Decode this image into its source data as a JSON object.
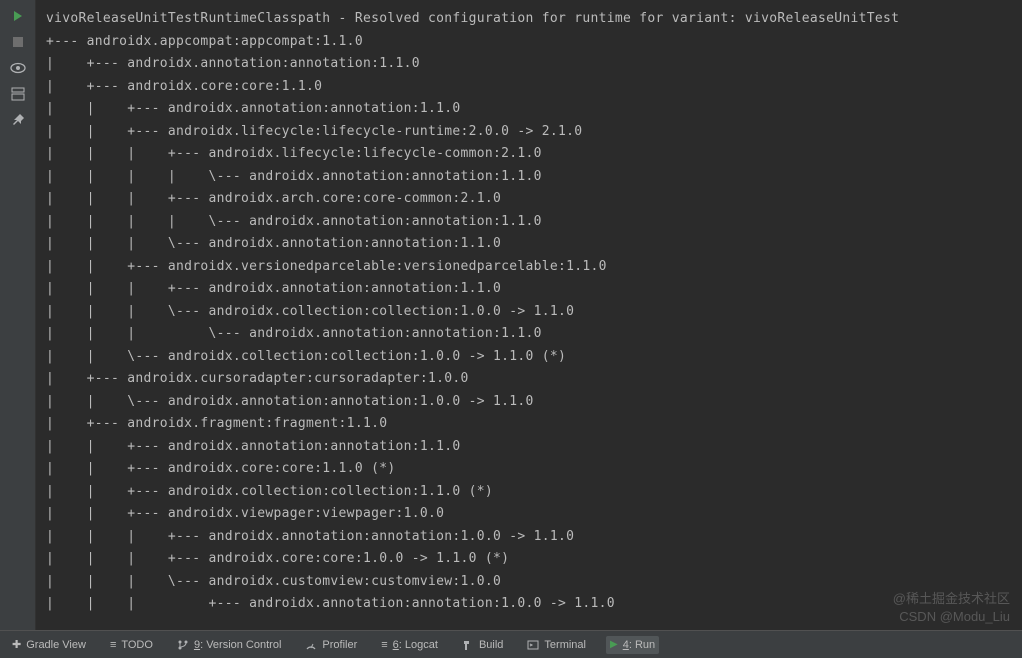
{
  "sidebar": {
    "icons": [
      "rerun",
      "stop",
      "view",
      "settings",
      "pin"
    ]
  },
  "console": {
    "lines": [
      "vivoReleaseUnitTestRuntimeClasspath - Resolved configuration for runtime for variant: vivoReleaseUnitTest",
      "+--- androidx.appcompat:appcompat:1.1.0",
      "|    +--- androidx.annotation:annotation:1.1.0",
      "|    +--- androidx.core:core:1.1.0",
      "|    |    +--- androidx.annotation:annotation:1.1.0",
      "|    |    +--- androidx.lifecycle:lifecycle-runtime:2.0.0 -> 2.1.0",
      "|    |    |    +--- androidx.lifecycle:lifecycle-common:2.1.0",
      "|    |    |    |    \\--- androidx.annotation:annotation:1.1.0",
      "|    |    |    +--- androidx.arch.core:core-common:2.1.0",
      "|    |    |    |    \\--- androidx.annotation:annotation:1.1.0",
      "|    |    |    \\--- androidx.annotation:annotation:1.1.0",
      "|    |    +--- androidx.versionedparcelable:versionedparcelable:1.1.0",
      "|    |    |    +--- androidx.annotation:annotation:1.1.0",
      "|    |    |    \\--- androidx.collection:collection:1.0.0 -> 1.1.0",
      "|    |    |         \\--- androidx.annotation:annotation:1.1.0",
      "|    |    \\--- androidx.collection:collection:1.0.0 -> 1.1.0 (*)",
      "|    +--- androidx.cursoradapter:cursoradapter:1.0.0",
      "|    |    \\--- androidx.annotation:annotation:1.0.0 -> 1.1.0",
      "|    +--- androidx.fragment:fragment:1.1.0",
      "|    |    +--- androidx.annotation:annotation:1.1.0",
      "|    |    +--- androidx.core:core:1.1.0 (*)",
      "|    |    +--- androidx.collection:collection:1.1.0 (*)",
      "|    |    +--- androidx.viewpager:viewpager:1.0.0",
      "|    |    |    +--- androidx.annotation:annotation:1.0.0 -> 1.1.0",
      "|    |    |    +--- androidx.core:core:1.0.0 -> 1.1.0 (*)",
      "|    |    |    \\--- androidx.customview:customview:1.0.0",
      "|    |    |         +--- androidx.annotation:annotation:1.0.0 -> 1.1.0"
    ]
  },
  "bottomBar": {
    "gradleView": "Gradle View",
    "todo": "TODO",
    "todoIcon": "≡",
    "versionControl": "Version Control",
    "versionControlKey": "9",
    "profiler": "Profiler",
    "logcat": "Logcat",
    "logcatKey": "6",
    "logcatIcon": "≡",
    "build": "Build",
    "terminal": "Terminal",
    "run": "Run",
    "runKey": "4"
  },
  "watermark": {
    "line1": "@稀土掘金技术社区",
    "line2": "CSDN @Modu_Liu"
  }
}
